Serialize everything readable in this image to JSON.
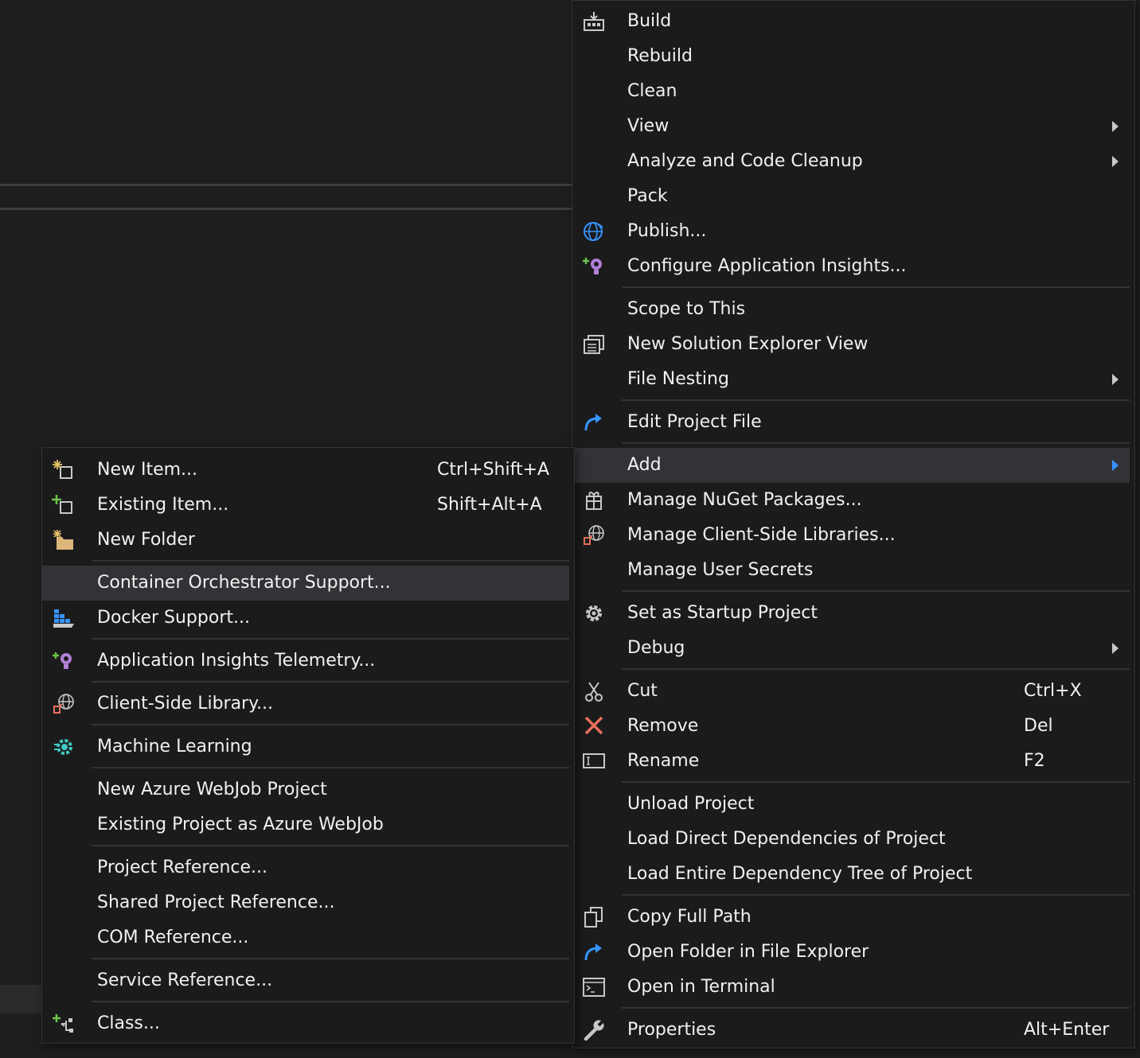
{
  "main_menu": {
    "build": "Build",
    "rebuild": "Rebuild",
    "clean": "Clean",
    "view": "View",
    "analyze": "Analyze and Code Cleanup",
    "pack": "Pack",
    "publish": "Publish...",
    "configure_ai": "Configure Application Insights...",
    "scope_to_this": "Scope to This",
    "new_solution_explorer_view": "New Solution Explorer View",
    "file_nesting": "File Nesting",
    "edit_project_file": "Edit Project File",
    "add": "Add",
    "manage_nuget": "Manage NuGet Packages...",
    "manage_client_libs": "Manage Client-Side Libraries...",
    "manage_user_secrets": "Manage User Secrets",
    "set_startup": "Set as Startup Project",
    "debug": "Debug",
    "cut": "Cut",
    "cut_shortcut": "Ctrl+X",
    "remove": "Remove",
    "remove_shortcut": "Del",
    "rename": "Rename",
    "rename_shortcut": "F2",
    "unload_project": "Unload Project",
    "load_direct_deps": "Load Direct Dependencies of Project",
    "load_entire_tree": "Load Entire Dependency Tree of Project",
    "copy_full_path": "Copy Full Path",
    "open_folder": "Open Folder in File Explorer",
    "open_terminal": "Open in Terminal",
    "properties": "Properties",
    "properties_shortcut": "Alt+Enter"
  },
  "add_submenu": {
    "new_item": "New Item...",
    "new_item_shortcut": "Ctrl+Shift+A",
    "existing_item": "Existing Item...",
    "existing_item_shortcut": "Shift+Alt+A",
    "new_folder": "New Folder",
    "container_orchestrator": "Container Orchestrator Support...",
    "docker_support": "Docker Support...",
    "ai_telemetry": "Application Insights Telemetry...",
    "client_side_library": "Client-Side Library...",
    "machine_learning": "Machine Learning",
    "new_azure_webjob": "New Azure WebJob Project",
    "existing_as_webjob": "Existing Project as Azure WebJob",
    "project_reference": "Project Reference...",
    "shared_project_reference": "Shared Project Reference...",
    "com_reference": "COM Reference...",
    "service_reference": "Service Reference...",
    "class": "Class..."
  },
  "colors": {
    "menu_background": "#1b1b1c",
    "highlight": "#333337",
    "text": "#f1f1f1",
    "submenu_arrow_active": "#3794ff",
    "remove_icon": "#e8705a"
  }
}
